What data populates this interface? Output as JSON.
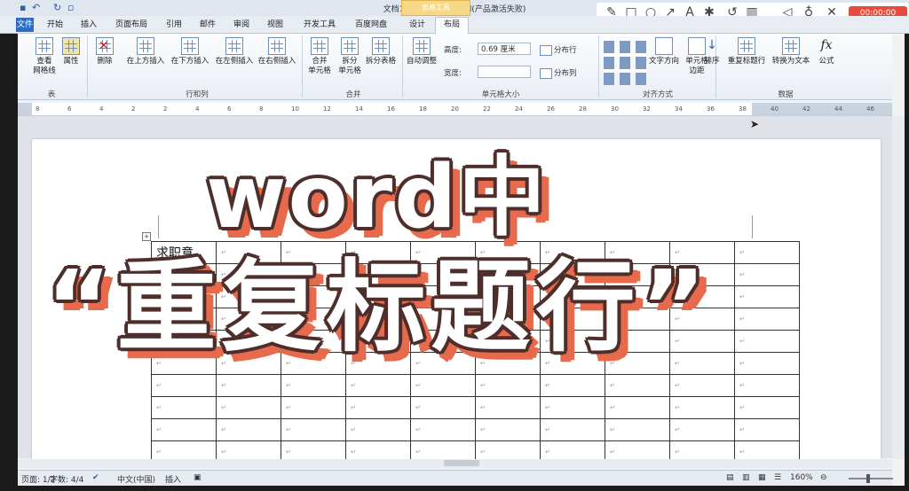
{
  "window": {
    "title": "文档1 - Microsoft Word(产品激活失败)",
    "context_group": "表格工具"
  },
  "tabs": [
    {
      "label": "文件"
    },
    {
      "label": "开始"
    },
    {
      "label": "插入"
    },
    {
      "label": "页面布局"
    },
    {
      "label": "引用"
    },
    {
      "label": "邮件"
    },
    {
      "label": "审阅"
    },
    {
      "label": "视图"
    },
    {
      "label": "开发工具"
    },
    {
      "label": "百度网盘"
    },
    {
      "label": "设计"
    },
    {
      "label": "布局"
    }
  ],
  "ribbon": {
    "table_group": {
      "view_gridlines": "查看\n网格线",
      "properties": "属性",
      "label": "表"
    },
    "rows_cols": {
      "delete": "删除",
      "insert_above": "在上方插入",
      "insert_below": "在下方插入",
      "insert_left": "在左侧插入",
      "insert_right": "在右侧插入",
      "label": "行和列"
    },
    "merge": {
      "merge_cells": "合并\n单元格",
      "split_cells": "拆分\n单元格",
      "split_table": "拆分表格",
      "label": "合并"
    },
    "cell_size": {
      "autofit": "自动调整",
      "height_label": "高度:",
      "height_value": "0.69 厘米",
      "width_label": "宽度:",
      "width_value": "",
      "distribute_rows": "分布行",
      "distribute_cols": "分布列",
      "label": "单元格大小"
    },
    "alignment": {
      "text_direction": "文字方向",
      "cell_margins": "单元格\n边距",
      "label": "对齐方式"
    },
    "data": {
      "sort": "排序",
      "repeat_header": "重复标题行",
      "convert_text": "转换为文本",
      "formula": "公式",
      "formula_icon": "fx",
      "label": "数据"
    }
  },
  "recorder": {
    "timer": "00:00:00"
  },
  "ruler_ticks": [
    "8",
    "6",
    "4",
    "2",
    "2",
    "4",
    "6",
    "8",
    "10",
    "12",
    "14",
    "16",
    "18",
    "20",
    "22",
    "24",
    "26",
    "28",
    "30",
    "32",
    "34",
    "36",
    "38",
    "40",
    "42",
    "44",
    "46"
  ],
  "document": {
    "first_cell": "求职意",
    "cell_mark": "↵"
  },
  "overlay": {
    "line1": "word中",
    "line2": "“重复标题行”"
  },
  "status": {
    "page": "页面: 1/2",
    "words": "字数: 4/4",
    "language": "中文(中国)",
    "mode": "插入",
    "zoom": "160%"
  }
}
